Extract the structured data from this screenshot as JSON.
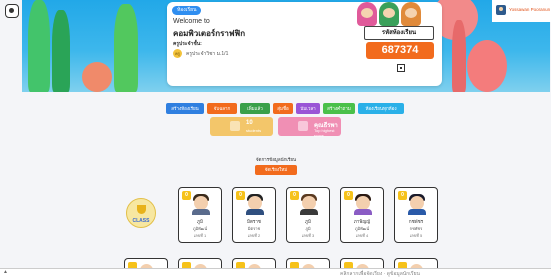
{
  "hero": {
    "chip": "ห้องเรียน",
    "welcome": "Welcome to",
    "class_name": "คอมพิวเตอร์กราฟฟิก",
    "teacher_label": "ครูประจำชั้น:",
    "teacher_avatar": "ครู",
    "teacher_name": "ครูประจำวิชา ม.1/1",
    "code_label": "รหัสห้องเรียน",
    "code_value": "687374"
  },
  "user": {
    "name": "Yossawan Pooranun"
  },
  "toolbar": [
    {
      "label": "สร้างห้องเรียน",
      "color": "#2f7fe0"
    },
    {
      "label": "จับฉลาก",
      "color": "#f26b1d"
    },
    {
      "label": "เพิ่มแล้ว",
      "color": "#3aa04a"
    },
    {
      "label": "สุ่มชื่อ",
      "color": "#f26b1d"
    },
    {
      "label": "นับเวลา",
      "color": "#9a55d6"
    },
    {
      "label": "สร้างคำถาม",
      "color": "#4ac04a"
    },
    {
      "label": "ห้องเรียนทุกห้อง",
      "color": "#2ab0e8"
    }
  ],
  "stats": [
    {
      "num": "10",
      "label": "students",
      "color": "#f3c66a"
    },
    {
      "num": "คุณธีรพา",
      "label": "Top highest score",
      "color": "#f08fb4"
    }
  ],
  "manage": {
    "label": "จัดการข้อมูลนักเรียน",
    "button": "จัดเรียงใหม่"
  },
  "trophy": {
    "label": "CLASS"
  },
  "students": [
    {
      "badge": "0",
      "nick": "ภูมิ",
      "fname": "ภูมิพัฒน์",
      "num": "เลขที่ 1",
      "hair": "#3a2a1a",
      "body": "#5a6b8c"
    },
    {
      "badge": "0",
      "nick": "มิตราช",
      "fname": "มิตราช",
      "num": "เลขที่ 2",
      "hair": "#222222",
      "body": "#2f4f7f"
    },
    {
      "badge": "0",
      "nick": "ภูมิ",
      "fname": "ภูมิ",
      "num": "เลขที่ 3",
      "hair": "#5a3a20",
      "body": "#3a3a3a"
    },
    {
      "badge": "0",
      "nick": "ภาพิญญ์",
      "fname": "ภูมิพัฒน์",
      "num": "เลขที่ 4",
      "hair": "#2b1a12",
      "body": "#8a5cc4"
    },
    {
      "badge": "0",
      "nick": "กชพัชร",
      "fname": "กชพัชร",
      "num": "เลขที่ 5",
      "hair": "#1a1a2a",
      "body": "#2a5aa8"
    }
  ],
  "footer": {
    "text": "คลิกลากเพื่อจัดเรียง · ดูข้อมูลนักเรียน"
  }
}
